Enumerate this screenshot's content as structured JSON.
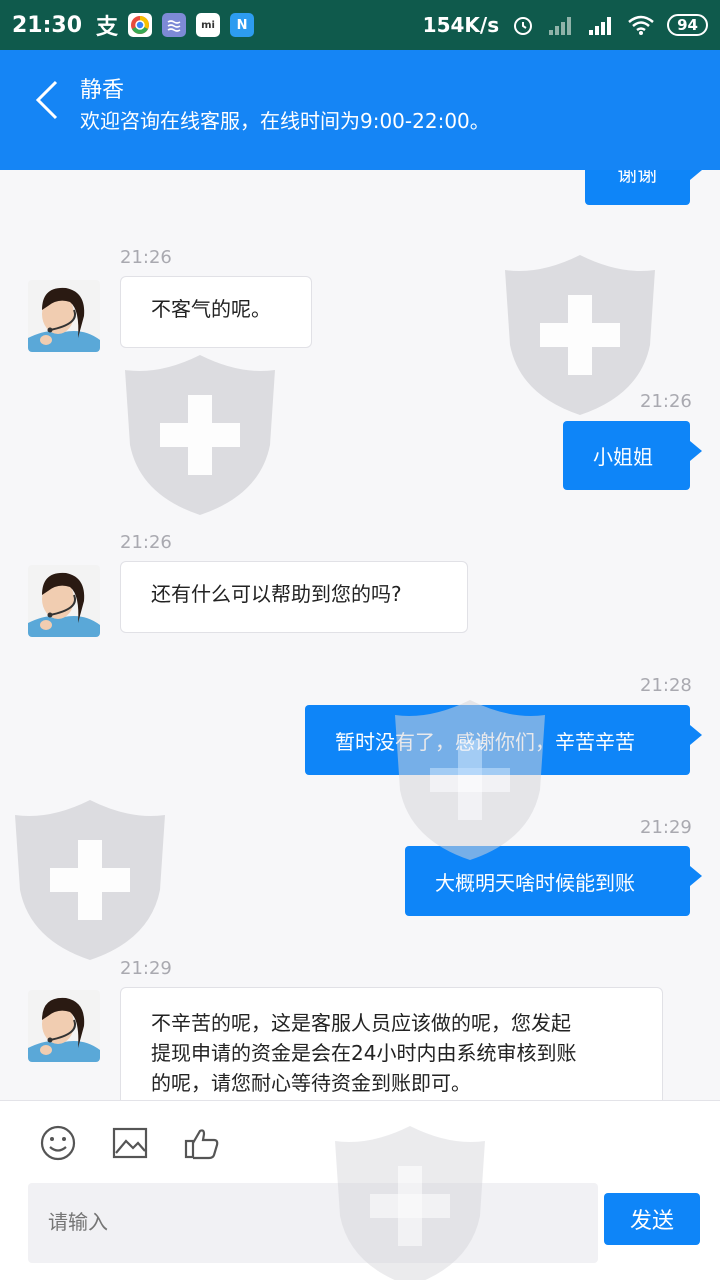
{
  "status_bar": {
    "time": "21:30",
    "alipay_glyph": "支",
    "network_speed": "154K/s",
    "battery": "94",
    "icons": [
      "alipay-icon",
      "chrome-icon",
      "app-icon",
      "mi-icon",
      "n-icon",
      "alarm-icon",
      "signal-icon",
      "signal-icon",
      "wifi-icon",
      "battery-icon"
    ]
  },
  "header": {
    "title": "静香",
    "subtitle": "欢迎咨询在线客服，在线时间为9:00-22:00。",
    "back_icon": "chevron-left-icon"
  },
  "messages": [
    {
      "direction": "out",
      "time": "",
      "text": "谢谢"
    },
    {
      "direction": "in",
      "time": "21:26",
      "text": "不客气的呢。"
    },
    {
      "direction": "out",
      "time": "21:26",
      "text": "小姐姐"
    },
    {
      "direction": "in",
      "time": "21:26",
      "text": "还有什么可以帮助到您的吗?"
    },
    {
      "direction": "out",
      "time": "21:28",
      "text": "暂时没有了，感谢你们，辛苦辛苦"
    },
    {
      "direction": "out",
      "time": "21:29",
      "text": "大概明天啥时候能到账"
    },
    {
      "direction": "in",
      "time": "21:29",
      "lines": [
        "不辛苦的呢，这是客服人员应该做的呢，您发起",
        "提现申请的资金是会在24小时内由系统审核到账",
        "的呢，请您耐心等待资金到账即可。"
      ]
    }
  ],
  "toolbar": {
    "icons": [
      "emoji-icon",
      "image-icon",
      "thumbs-up-icon"
    ],
    "input_placeholder": "请输入",
    "send_label": "发送"
  },
  "colors": {
    "accent": "#1585f5",
    "bubble_out": "#0e85f8",
    "status_bar": "#0f5a4c"
  }
}
